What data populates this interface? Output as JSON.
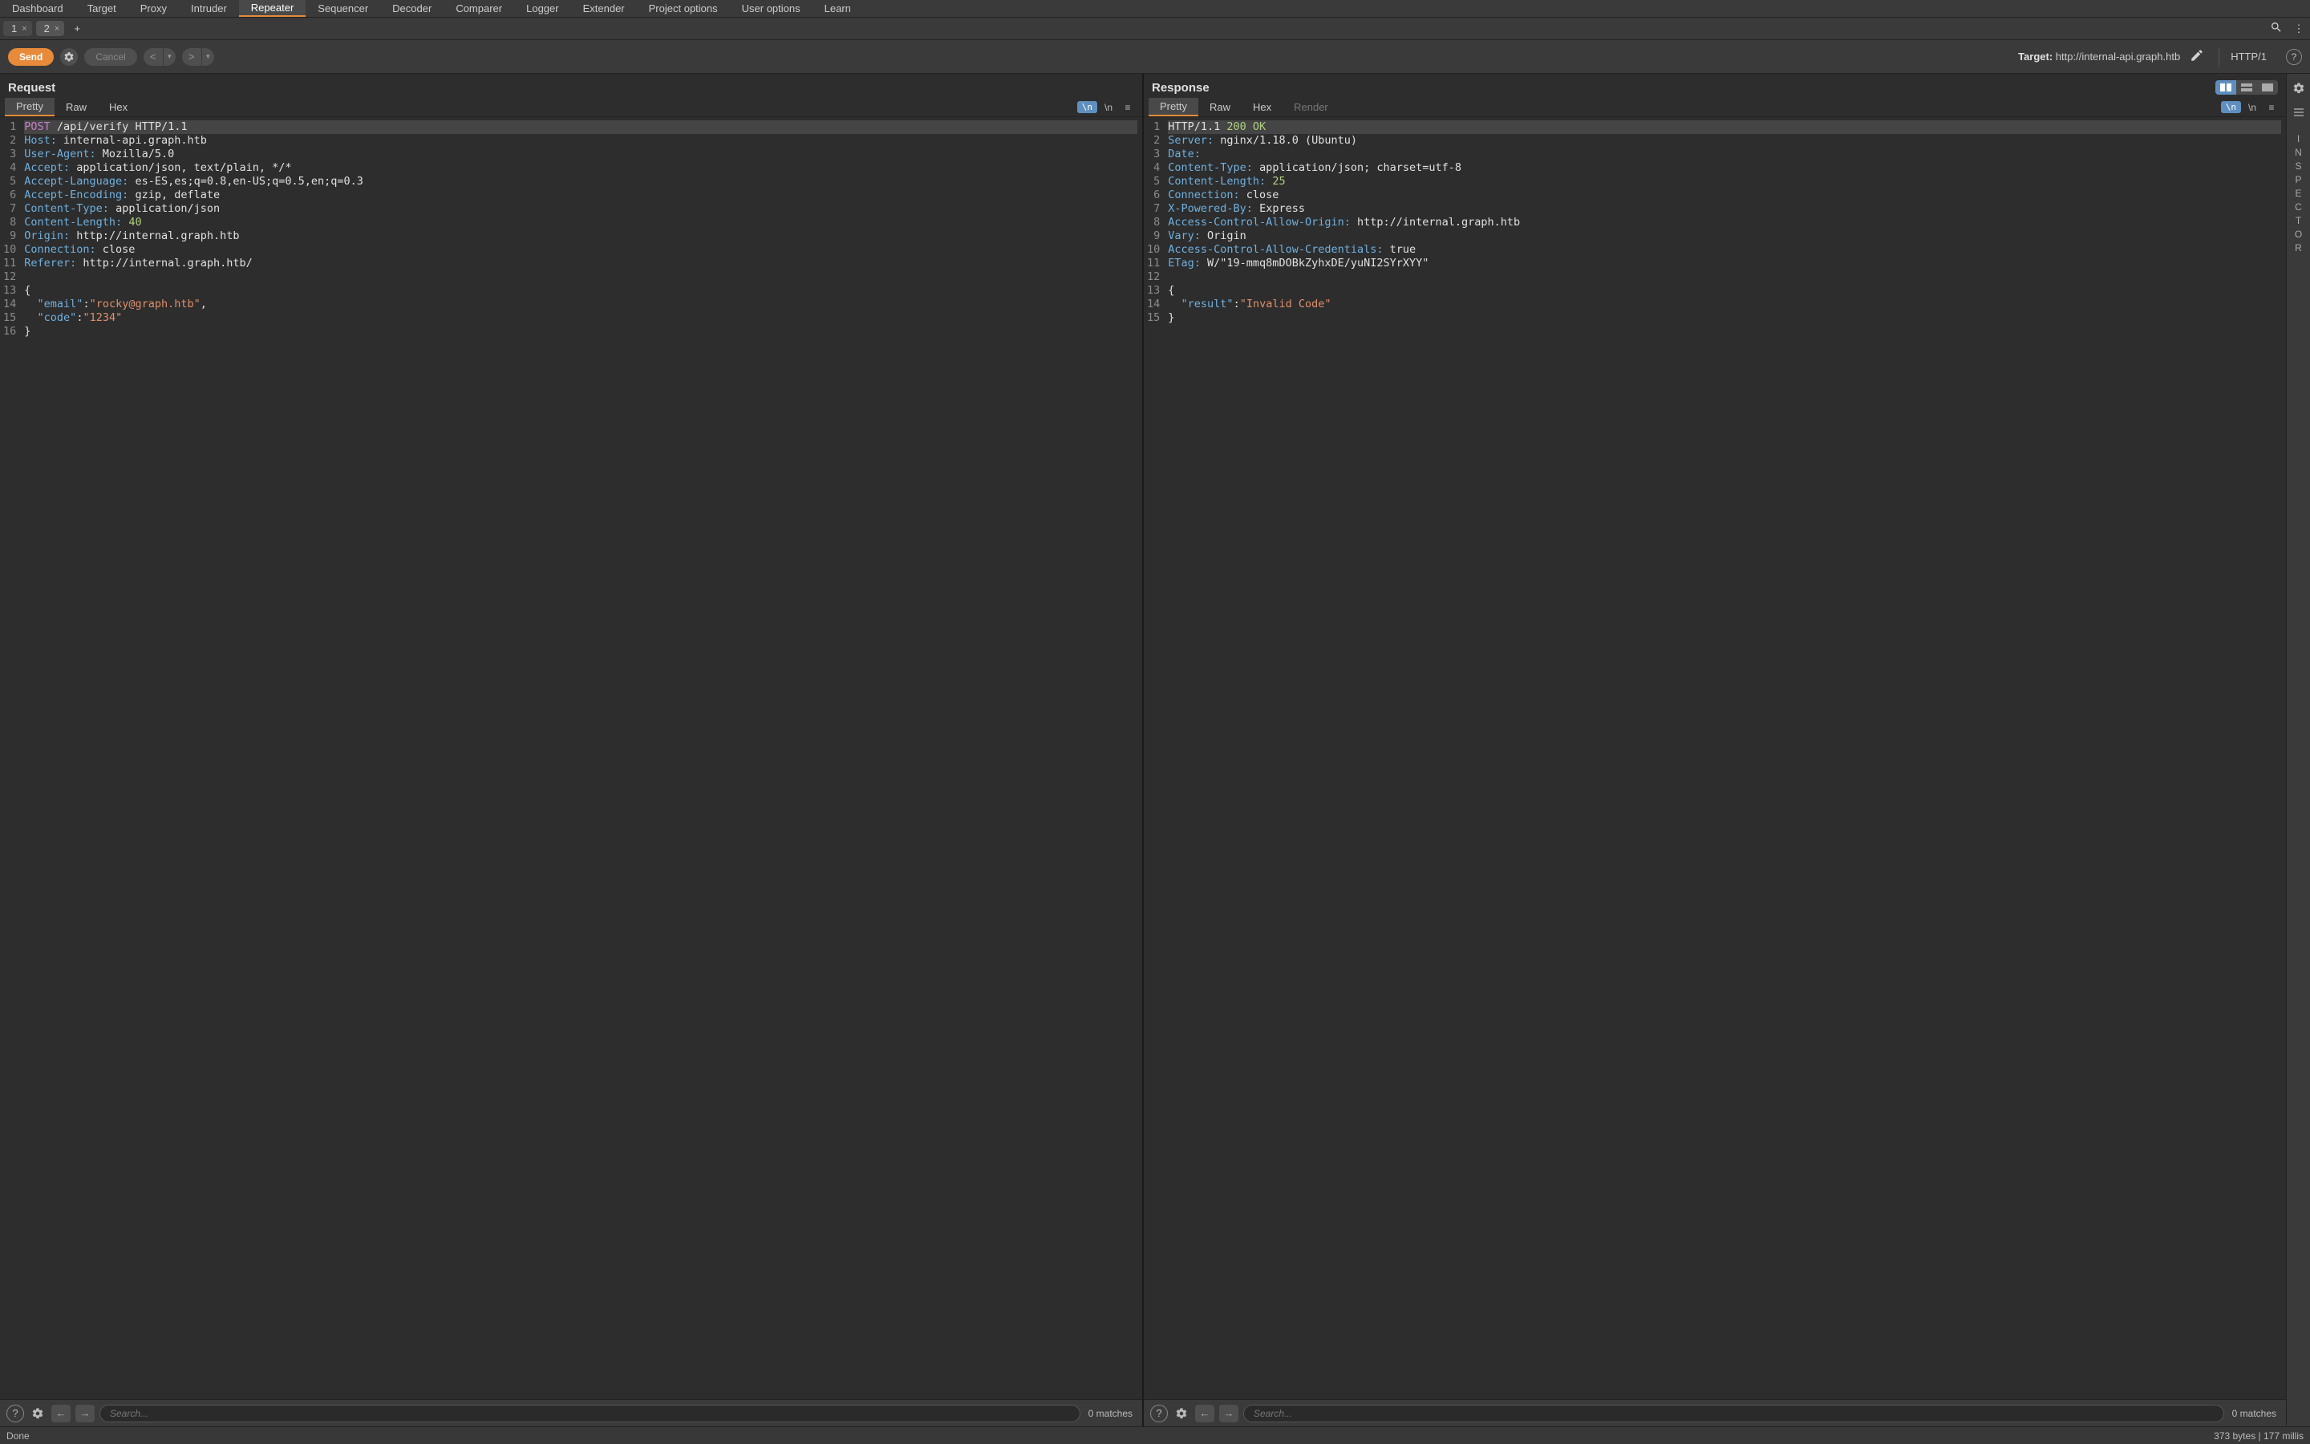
{
  "menu": {
    "items": [
      "Dashboard",
      "Target",
      "Proxy",
      "Intruder",
      "Repeater",
      "Sequencer",
      "Decoder",
      "Comparer",
      "Logger",
      "Extender",
      "Project options",
      "User options",
      "Learn"
    ],
    "active_index": 4
  },
  "subtabs": {
    "tabs": [
      "1",
      "2"
    ],
    "active_index": 1
  },
  "toolbar": {
    "send_label": "Send",
    "cancel_label": "Cancel",
    "target_prefix": "Target: ",
    "target_value": "http://internal-api.graph.htb",
    "http_version": "HTTP/1"
  },
  "panes": {
    "request": {
      "title": "Request",
      "tabs": [
        "Pretty",
        "Raw",
        "Hex"
      ],
      "active_tab": 0,
      "lines": [
        [
          [
            "method",
            "POST"
          ],
          [
            "val",
            " /api/verify HTTP/1.1"
          ]
        ],
        [
          [
            "key",
            "Host:"
          ],
          [
            "val",
            " internal-api.graph.htb"
          ]
        ],
        [
          [
            "key",
            "User-Agent:"
          ],
          [
            "val",
            " Mozilla/5.0"
          ]
        ],
        [
          [
            "key",
            "Accept:"
          ],
          [
            "val",
            " application/json, text/plain, */*"
          ]
        ],
        [
          [
            "key",
            "Accept-Language:"
          ],
          [
            "val",
            " es-ES,es;q=0.8,en-US;q=0.5,en;q=0.3"
          ]
        ],
        [
          [
            "key",
            "Accept-Encoding:"
          ],
          [
            "val",
            " gzip, deflate"
          ]
        ],
        [
          [
            "key",
            "Content-Type:"
          ],
          [
            "val",
            " application/json"
          ]
        ],
        [
          [
            "key",
            "Content-Length:"
          ],
          [
            "val",
            " "
          ],
          [
            "num",
            "40"
          ]
        ],
        [
          [
            "key",
            "Origin:"
          ],
          [
            "val",
            " http://internal.graph.htb"
          ]
        ],
        [
          [
            "key",
            "Connection:"
          ],
          [
            "val",
            " close"
          ]
        ],
        [
          [
            "key",
            "Referer:"
          ],
          [
            "val",
            " http://internal.graph.htb/"
          ]
        ],
        [],
        [
          [
            "val",
            "{"
          ]
        ],
        [
          [
            "jkey",
            "\"email\""
          ],
          [
            "val",
            ":"
          ],
          [
            "jstr",
            "\"rocky@graph.htb\""
          ],
          [
            "val",
            ","
          ]
        ],
        [
          [
            "jkey",
            "\"code\""
          ],
          [
            "val",
            ":"
          ],
          [
            "jstr",
            "\"1234\""
          ]
        ],
        [
          [
            "val",
            "}"
          ]
        ]
      ],
      "highlight_line": 0,
      "search_placeholder": "Search...",
      "matches_label": "0 matches"
    },
    "response": {
      "title": "Response",
      "tabs": [
        "Pretty",
        "Raw",
        "Hex",
        "Render"
      ],
      "active_tab": 0,
      "lines": [
        [
          [
            "val",
            "HTTP/1.1 "
          ],
          [
            "status",
            "200 OK"
          ]
        ],
        [
          [
            "key",
            "Server:"
          ],
          [
            "val",
            " nginx/1.18.0 (Ubuntu)"
          ]
        ],
        [
          [
            "key",
            "Date:"
          ],
          [
            "val",
            " "
          ]
        ],
        [
          [
            "key",
            "Content-Type:"
          ],
          [
            "val",
            " application/json; charset=utf-8"
          ]
        ],
        [
          [
            "key",
            "Content-Length:"
          ],
          [
            "val",
            " "
          ],
          [
            "num",
            "25"
          ]
        ],
        [
          [
            "key",
            "Connection:"
          ],
          [
            "val",
            " close"
          ]
        ],
        [
          [
            "key",
            "X-Powered-By:"
          ],
          [
            "val",
            " Express"
          ]
        ],
        [
          [
            "key",
            "Access-Control-Allow-Origin:"
          ],
          [
            "val",
            " http://internal.graph.htb"
          ]
        ],
        [
          [
            "key",
            "Vary:"
          ],
          [
            "val",
            " Origin"
          ]
        ],
        [
          [
            "key",
            "Access-Control-Allow-Credentials:"
          ],
          [
            "val",
            " true"
          ]
        ],
        [
          [
            "key",
            "ETag:"
          ],
          [
            "val",
            " W/\"19-mmq8mDOBkZyhxDE/yuNI2SYrXYY\""
          ]
        ],
        [],
        [
          [
            "val",
            "{"
          ]
        ],
        [
          [
            "jkey",
            "\"result\""
          ],
          [
            "val",
            ":"
          ],
          [
            "jstr",
            "\"Invalid Code\""
          ]
        ],
        [
          [
            "val",
            "}"
          ]
        ]
      ],
      "highlight_line": 0,
      "search_placeholder": "Search...",
      "matches_label": "0 matches"
    }
  },
  "inspector_label": "INSPECTOR",
  "status": {
    "left": "Done",
    "right": "373 bytes | 177 millis"
  },
  "newline_label": "\\n"
}
